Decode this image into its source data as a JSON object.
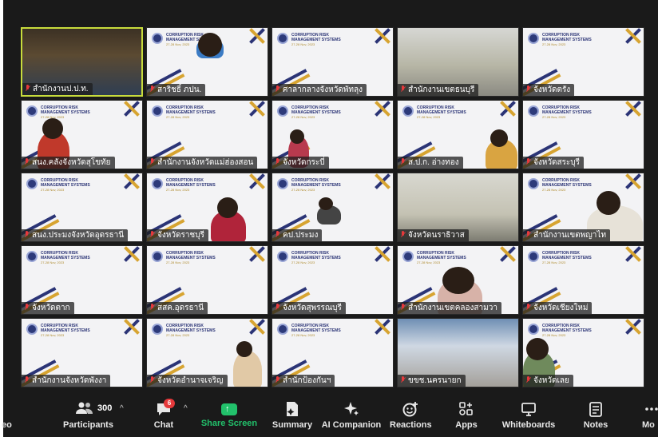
{
  "meeting": {
    "tiles": [
      {
        "name": "สำนักงานป.ป.ท.",
        "bg": "conf",
        "active": true
      },
      {
        "name": "สาริชธิ์ ภปน.",
        "bg": "brand"
      },
      {
        "name": "ศาลากลางจังหวัดพัทลุง",
        "bg": "brand"
      },
      {
        "name": "สำนักงานเขตธนบุรี",
        "bg": "room"
      },
      {
        "name": "จังหวัดตรัง",
        "bg": "brand"
      },
      {
        "name": "สนง.คลังจังหวัดสุโขทัย",
        "bg": "brand"
      },
      {
        "name": "สำนักงานจังหวัดแม่ฮ่องสอน",
        "bg": "brand"
      },
      {
        "name": "จังหวัดกระบี่",
        "bg": "brand"
      },
      {
        "name": "ส.ป.ก. อ่างทอง",
        "bg": "brand"
      },
      {
        "name": "จังหวัดสระบุรี",
        "bg": "brand"
      },
      {
        "name": "สนง.ประมงจังหวัดอุดรธานี",
        "bg": "brand"
      },
      {
        "name": "จังหวัดราชบุรี",
        "bg": "brand"
      },
      {
        "name": "คป.ประมง",
        "bg": "brand"
      },
      {
        "name": "จังหวัดนราธิวาส",
        "bg": "room2"
      },
      {
        "name": "สำนักงานเขตพญาไท",
        "bg": "brand"
      },
      {
        "name": "จังหวัดตาก",
        "bg": "brand"
      },
      {
        "name": "สสค.อุดรธานี",
        "bg": "brand"
      },
      {
        "name": "จังหวัดสุพรรณบุรี",
        "bg": "brand"
      },
      {
        "name": "สำนักงานเขตคลองสามวา",
        "bg": "brand"
      },
      {
        "name": "จังหวัดเชียงใหม่",
        "bg": "brand"
      },
      {
        "name": "สำนักงานจังหวัดพังงา",
        "bg": "brand"
      },
      {
        "name": "จังหวัดอำนาจเจริญ",
        "bg": "brand"
      },
      {
        "name": "สำนักป้องกันฯ",
        "bg": "brand"
      },
      {
        "name": "ขขช.นครนายก",
        "bg": "hall"
      },
      {
        "name": "จังหวัดเลย",
        "bg": "brand"
      }
    ],
    "brand": {
      "line1": "CORRUPTION RISK",
      "line2": "MANAGEMENT SYSTEMS",
      "date": "27-28 Nov, 2023"
    },
    "tile15_sign": "จังหวัดตาก"
  },
  "toolbar": {
    "left_edge": "eo",
    "participants_count": "300",
    "participants": "Participants",
    "chat_badge": "6",
    "chat": "Chat",
    "share": "Share Screen",
    "summary": "Summary",
    "ai": "AI Companion",
    "reactions": "Reactions",
    "apps": "Apps",
    "whiteboards": "Whiteboards",
    "notes": "Notes",
    "right_edge": "Mo",
    "caret": "^",
    "colors": {
      "bg": "#1a1a1a",
      "share": "#22c16b",
      "badge": "#e6393b",
      "active_border": "#c8dc3c"
    }
  }
}
